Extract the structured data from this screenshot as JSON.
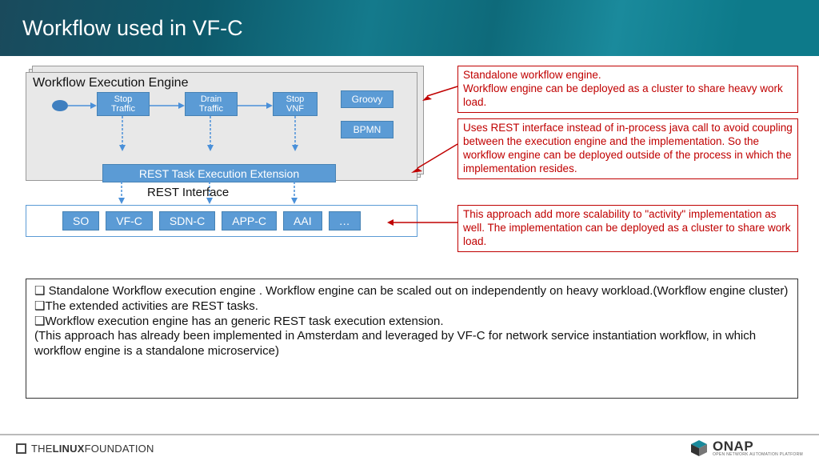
{
  "header": {
    "title": "Workflow used in VF-C"
  },
  "wfe": {
    "panel_title": "Workflow Execution Engine",
    "tasks": {
      "t1": "Stop\nTraffic",
      "t2": "Drain\nTraffic",
      "t3": "Stop\nVNF"
    },
    "badges": {
      "b1": "Groovy",
      "b2": "BPMN"
    },
    "rest_ext": "REST Task Execution Extension",
    "rest_if": "REST Interface"
  },
  "services": {
    "s1": "SO",
    "s2": "VF-C",
    "s3": "SDN-C",
    "s4": "APP-C",
    "s5": "AAI",
    "s6": "…"
  },
  "callouts": {
    "c1": "Standalone workflow engine.\nWorkflow engine can be deployed as a cluster to share heavy work load.",
    "c2": "Uses REST interface instead of in-process java call to avoid coupling between the execution engine and the implementation. So the workflow engine can be deployed outside of the process in which the implementation resides.",
    "c3": "This approach add more scalability to \"activity\" implementation as well. The implementation can be deployed as a cluster to share work load."
  },
  "bullets": {
    "l1": "Standalone Workflow execution engine . Workflow engine can be scaled out on independently on heavy workload.(Workflow engine cluster)",
    "l2": "The extended activities are REST tasks.",
    "l3": "Workflow execution engine has an generic REST task execution extension.",
    "l4": "(This approach has already been implemented in Amsterdam and leveraged by VF-C for network service instantiation workflow, in which workflow engine is a standalone microservice)"
  },
  "footer": {
    "linux_a": "THE",
    "linux_b": "LINUX",
    "linux_c": "FOUNDATION",
    "onap": "ONAP",
    "onap_sub": "OPEN NETWORK AUTOMATION PLATFORM"
  }
}
